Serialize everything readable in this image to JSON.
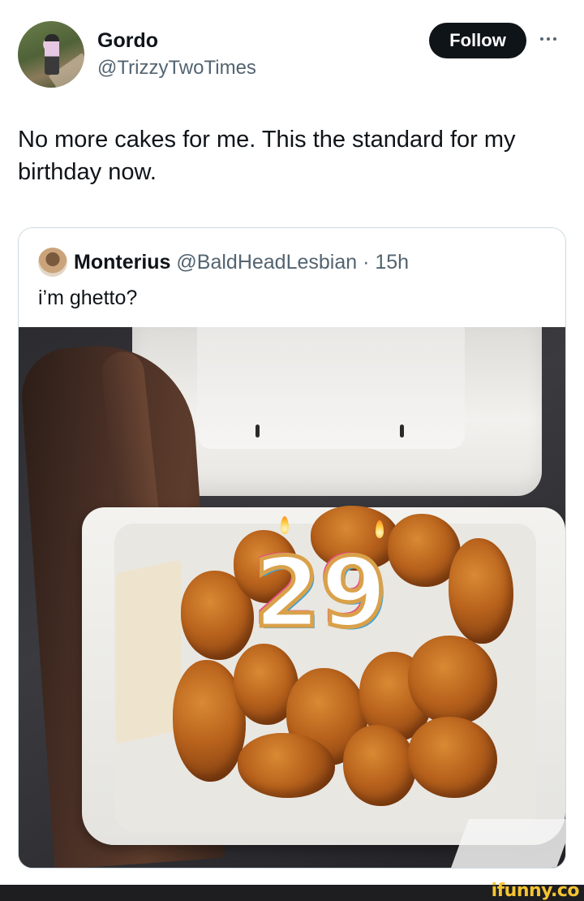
{
  "author": {
    "name": "Gordo",
    "handle": "@TrizzyTwoTimes",
    "follow_label": "Follow"
  },
  "tweet": {
    "text": "No more cakes for me. This the standard for my birthday now."
  },
  "quoted": {
    "name": "Monterius",
    "meta": "@BaldHeadLesbian · 15h",
    "text": "i’m ghetto?"
  },
  "photo": {
    "candle_digits": "29"
  },
  "watermark": {
    "text": "ifunny.co"
  },
  "colors": {
    "follow_bg": "#0f1419",
    "secondary_text": "#536471",
    "border": "#cfd9de",
    "watermark": "#f6c431"
  }
}
